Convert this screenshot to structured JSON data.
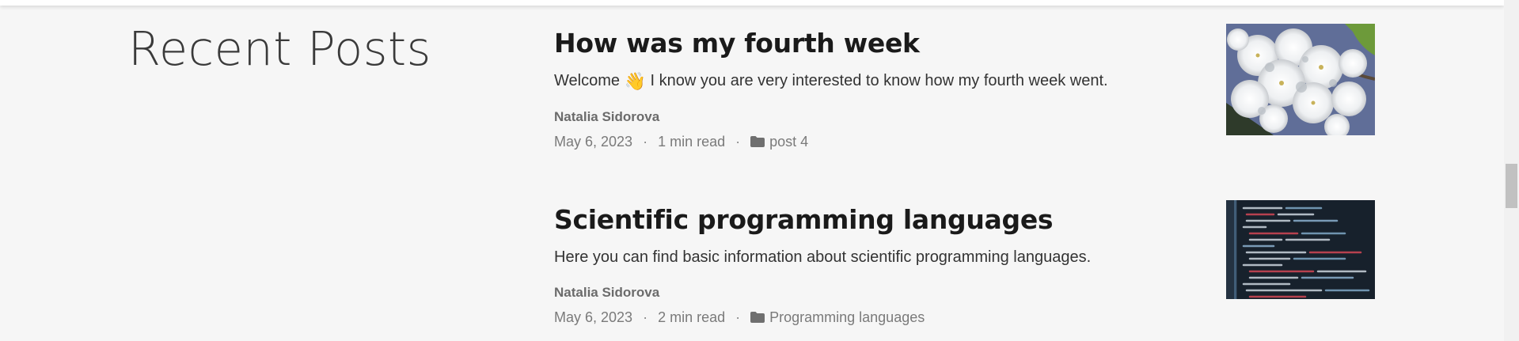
{
  "section": {
    "title": "Recent Posts"
  },
  "posts": [
    {
      "title": "How was my fourth week",
      "excerpt_before": "Welcome",
      "excerpt_emoji": "👋",
      "excerpt_after": "I know you are very interested to know how my fourth week went.",
      "author": "Natalia Sidorova",
      "date": "May 6, 2023",
      "read_time": "1 min read",
      "separator": "·",
      "category": "post 4",
      "thumbnail_icon": "cherry-blossom-photo"
    },
    {
      "title": "Scientific programming languages",
      "excerpt": "Here you can find basic information about scientific programming languages.",
      "author": "Natalia Sidorova",
      "date": "May 6, 2023",
      "read_time": "2 min read",
      "separator": "·",
      "category": "Programming languages",
      "thumbnail_icon": "code-screen-photo"
    }
  ],
  "colors": {
    "background": "#f6f6f6",
    "title": "#1a1a1a",
    "meta": "#7a7a7a",
    "author": "#6b6b6b"
  }
}
